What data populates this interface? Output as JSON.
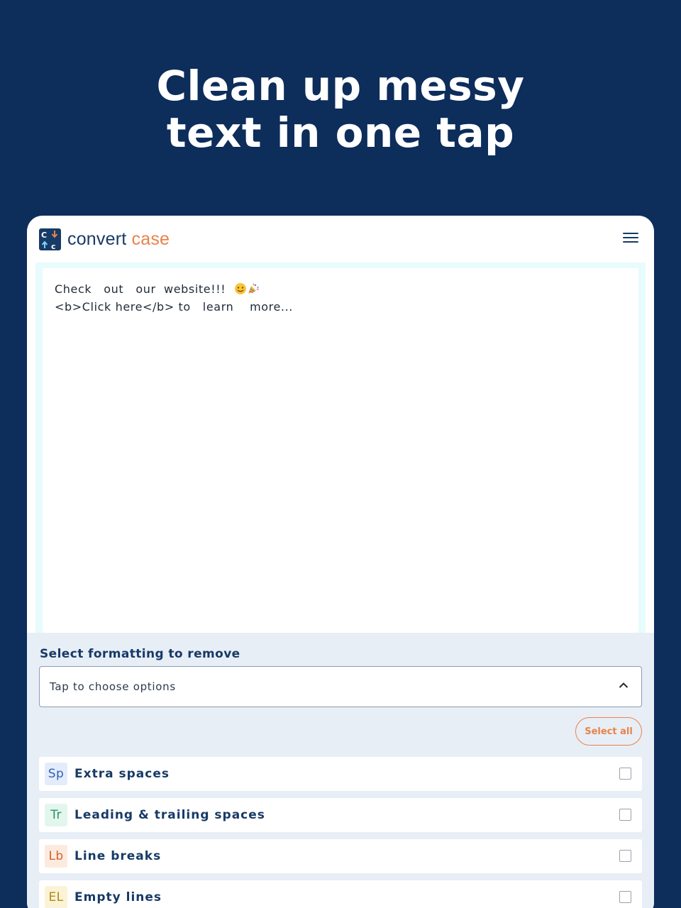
{
  "headline": {
    "line1": "Clean up messy",
    "line2": "text in one tap"
  },
  "app": {
    "brand_part1": "convert",
    "brand_part2": "case",
    "menu_icon": "hamburger-menu-icon"
  },
  "editor": {
    "line1_text": "Check   out   our  website!!!  ",
    "line2_text": "<b>Click here</b> to   learn    more...",
    "emojis": [
      "smiling-face-icon",
      "party-popper-icon"
    ]
  },
  "options": {
    "title": "Select formatting to remove",
    "dropdown_placeholder": "Tap to choose options",
    "select_all_label": "Select all",
    "items": [
      {
        "badge": "Sp",
        "label": "Extra spaces",
        "badge_color": "#2f62b3",
        "badge_bg": "#e4ecfb",
        "checked": false
      },
      {
        "badge": "Tr",
        "label": "Leading & trailing spaces",
        "badge_color": "#2f8f6a",
        "badge_bg": "#e3f6ee",
        "checked": false
      },
      {
        "badge": "Lb",
        "label": "Line breaks",
        "badge_color": "#d0632a",
        "badge_bg": "#fdeadf",
        "checked": false
      },
      {
        "badge": "EL",
        "label": "Empty lines",
        "badge_color": "#b08a12",
        "badge_bg": "#fbf3d6",
        "checked": false
      }
    ]
  },
  "colors": {
    "background": "#0d2d5b",
    "brand_navy": "#173a66",
    "accent_orange": "#e8834a"
  }
}
